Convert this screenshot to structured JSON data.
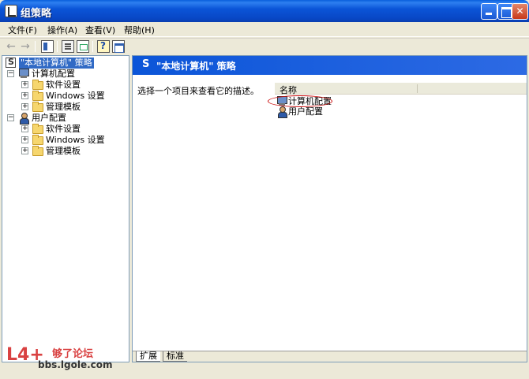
{
  "window": {
    "title": "组策略",
    "icon": "app-icon"
  },
  "menu": {
    "items": [
      "文件(F)",
      "操作(A)",
      "查看(V)",
      "帮助(H)"
    ]
  },
  "toolbar": {
    "icons": [
      "back-arrow-icon",
      "forward-arrow-icon",
      "show-hide-tree-icon",
      "properties-icon",
      "export-list-icon",
      "help-icon",
      "view-icon"
    ]
  },
  "tree": {
    "root": "\"本地计算机\" 策略",
    "nodes": [
      {
        "label": "计算机配置",
        "level": 1,
        "icon": "computer-icon",
        "expander": "−"
      },
      {
        "label": "软件设置",
        "level": 2,
        "icon": "folder-icon",
        "expander": "+"
      },
      {
        "label": "Windows 设置",
        "level": 2,
        "icon": "folder-icon",
        "expander": "+"
      },
      {
        "label": "管理模板",
        "level": 2,
        "icon": "folder-icon",
        "expander": "+"
      },
      {
        "label": "用户配置",
        "level": 1,
        "icon": "user-icon",
        "expander": "−"
      },
      {
        "label": "软件设置",
        "level": 2,
        "icon": "folder-icon",
        "expander": "+"
      },
      {
        "label": "Windows 设置",
        "level": 2,
        "icon": "folder-icon",
        "expander": "+"
      },
      {
        "label": "管理模板",
        "level": 2,
        "icon": "folder-icon",
        "expander": "+"
      }
    ]
  },
  "content": {
    "header_title": "\"本地计算机\" 策略",
    "description": "选择一个项目来查看它的描述。",
    "column_name": "名称",
    "items": [
      "计算机配置",
      "用户配置"
    ],
    "tabs": [
      "扩展",
      "标准"
    ]
  },
  "watermark": {
    "logo": "L4+",
    "name": "够了论坛",
    "url": "bbs.lgole.com"
  },
  "colors": {
    "titlebar": "#0b55d8",
    "selection": "#316ac5",
    "highlight_ring": "#cc1111"
  }
}
